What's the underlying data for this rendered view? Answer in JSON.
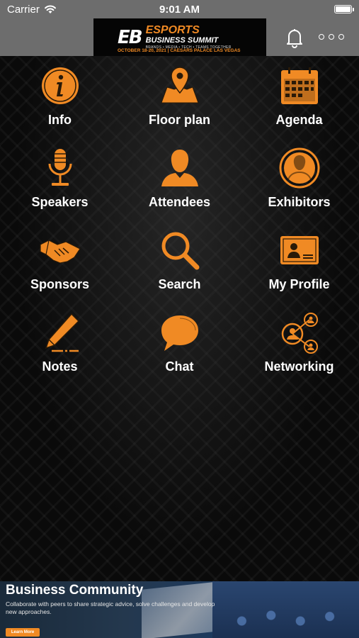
{
  "status_bar": {
    "carrier": "Carrier",
    "time": "9:01 AM"
  },
  "header": {
    "logo": {
      "mark": "EB",
      "line1": "ESPORTS",
      "line2": "BUSINESS SUMMIT",
      "line3": "BRANDS • MEDIA • TECH • TEAMS TOGETHER",
      "line4": "OCTOBER 18-20, 2021 | CAESARS PALACE LAS VEGAS"
    },
    "icons": [
      "bell-icon",
      "more-icon"
    ]
  },
  "colors": {
    "accent": "#f08a24",
    "bar": "#6d6d6d",
    "background": "#0a0a0a"
  },
  "menu": {
    "items": [
      {
        "label": "Info",
        "icon": "info-icon"
      },
      {
        "label": "Floor plan",
        "icon": "map-icon"
      },
      {
        "label": "Agenda",
        "icon": "calendar-icon"
      },
      {
        "label": "Speakers",
        "icon": "microphone-icon"
      },
      {
        "label": "Attendees",
        "icon": "person-icon"
      },
      {
        "label": "Exhibitors",
        "icon": "person-circle-icon"
      },
      {
        "label": "Sponsors",
        "icon": "handshake-icon"
      },
      {
        "label": "Search",
        "icon": "magnifier-icon"
      },
      {
        "label": "My Profile",
        "icon": "id-card-icon"
      },
      {
        "label": "Notes",
        "icon": "pen-icon"
      },
      {
        "label": "Chat",
        "icon": "chat-bubble-icon"
      },
      {
        "label": "Networking",
        "icon": "network-icon"
      }
    ]
  },
  "banner": {
    "title": "Business Community",
    "text": "Collaborate with peers to share strategic advice, solve challenges and develop new approaches.",
    "button": "Learn More"
  }
}
